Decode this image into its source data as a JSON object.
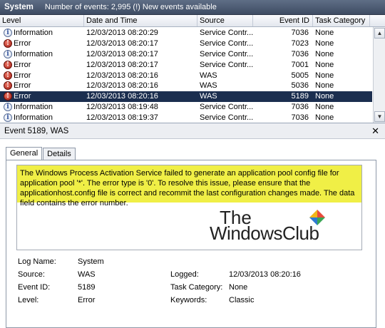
{
  "titlebar": {
    "title": "System",
    "status": "Number of events: 2,995 (!) New events available"
  },
  "columns": [
    "Level",
    "Date and Time",
    "Source",
    "Event ID",
    "Task Category"
  ],
  "rows": [
    {
      "level": "Information",
      "icon": "info-icon",
      "date": "12/03/2013 08:20:29",
      "source": "Service Contr...",
      "id": "7036",
      "category": "None",
      "selected": false
    },
    {
      "level": "Error",
      "icon": "error-icon",
      "date": "12/03/2013 08:20:17",
      "source": "Service Contr...",
      "id": "7023",
      "category": "None",
      "selected": false
    },
    {
      "level": "Information",
      "icon": "info-icon",
      "date": "12/03/2013 08:20:17",
      "source": "Service Contr...",
      "id": "7036",
      "category": "None",
      "selected": false
    },
    {
      "level": "Error",
      "icon": "error-icon",
      "date": "12/03/2013 08:20:17",
      "source": "Service Contr...",
      "id": "7001",
      "category": "None",
      "selected": false
    },
    {
      "level": "Error",
      "icon": "error-icon",
      "date": "12/03/2013 08:20:16",
      "source": "WAS",
      "id": "5005",
      "category": "None",
      "selected": false
    },
    {
      "level": "Error",
      "icon": "error-icon",
      "date": "12/03/2013 08:20:16",
      "source": "WAS",
      "id": "5036",
      "category": "None",
      "selected": false
    },
    {
      "level": "Error",
      "icon": "error-icon",
      "date": "12/03/2013 08:20:16",
      "source": "WAS",
      "id": "5189",
      "category": "None",
      "selected": true
    },
    {
      "level": "Information",
      "icon": "info-icon",
      "date": "12/03/2013 08:19:48",
      "source": "Service Contr...",
      "id": "7036",
      "category": "None",
      "selected": false
    },
    {
      "level": "Information",
      "icon": "info-icon",
      "date": "12/03/2013 08:19:37",
      "source": "Service Contr...",
      "id": "7036",
      "category": "None",
      "selected": false
    }
  ],
  "detail": {
    "title": "Event 5189, WAS",
    "tabs": [
      "General",
      "Details"
    ],
    "description": "The Windows Process Activation Service failed to generate an application pool config file for application pool '*'. The error type is '0'. To resolve this issue, please ensure that the applicationhost.config file is correct and recommit the last configuration changes made. The data field contains the error number.",
    "watermark": {
      "line1": "The",
      "line2": "WindowsClub"
    },
    "properties": {
      "log_name_label": "Log Name:",
      "log_name": "System",
      "source_label": "Source:",
      "source": "WAS",
      "logged_label": "Logged:",
      "logged": "12/03/2013 08:20:16",
      "event_id_label": "Event ID:",
      "event_id": "5189",
      "task_category_label": "Task Category:",
      "task_category": "None",
      "level_label": "Level:",
      "level": "Error",
      "keywords_label": "Keywords:",
      "keywords": "Classic"
    }
  },
  "colors": {
    "selected_row": "#1b2e4f",
    "highlight": "#f0ef46",
    "error_icon": "#c0281a",
    "info_icon": "#2a4c99"
  }
}
